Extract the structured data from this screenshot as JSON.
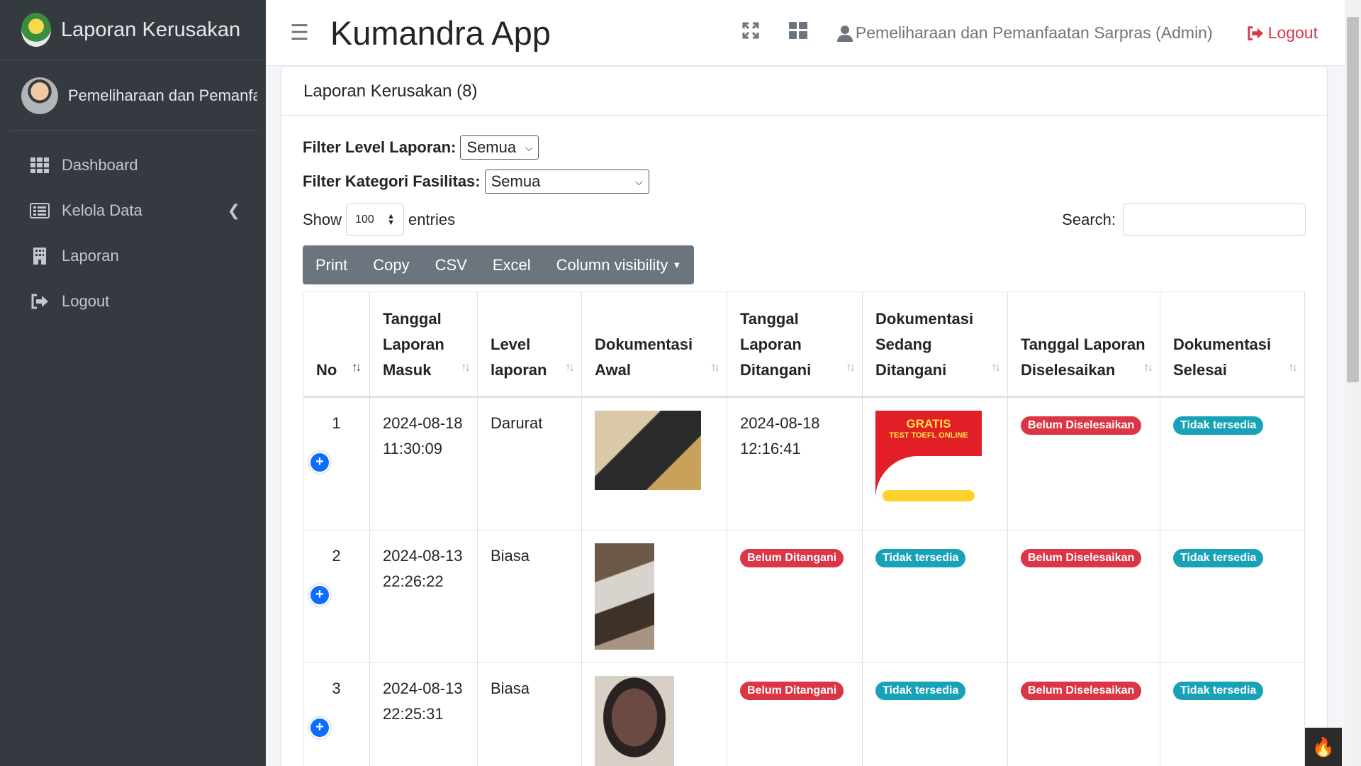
{
  "sidebar": {
    "brand": "Laporan Kerusakan",
    "user_name": "Pemeliharaan dan Pemanfaatan Sarpras",
    "menu": [
      {
        "label": "Dashboard",
        "icon": "grid-icon"
      },
      {
        "label": "Kelola Data",
        "icon": "table-icon"
      },
      {
        "label": "Laporan",
        "icon": "building-icon"
      },
      {
        "label": "Logout",
        "icon": "logout-icon"
      }
    ]
  },
  "header": {
    "title": "Kumandra App",
    "user": "Pemeliharaan dan Pemanfaatan Sarpras (Admin)",
    "logout": "Logout"
  },
  "card": {
    "title": "Laporan Kerusakan (8)",
    "filter_level_label": "Filter Level Laporan:",
    "filter_level_value": "Semua",
    "filter_kategori_label": "Filter Kategori Fasilitas:",
    "filter_kategori_value": "Semua",
    "show_label": "Show",
    "entries_value": "100",
    "entries_label": "entries",
    "search_label": "Search:",
    "buttons": [
      "Print",
      "Copy",
      "CSV",
      "Excel",
      "Column visibility"
    ]
  },
  "table": {
    "headers": [
      "No",
      "Tanggal Laporan Masuk",
      "Level laporan",
      "Dokumentasi Awal",
      "Tanggal Laporan Ditangani",
      "Dokumentasi Sedang Ditangani",
      "Tanggal Laporan Diselesaikan",
      "Dokumentasi Selesai"
    ],
    "rows": [
      {
        "no": "1",
        "masuk_date": "2024-08-18",
        "masuk_time": "11:30:09",
        "level": "Darurat",
        "ditangani_date": "2024-08-18",
        "ditangani_time": "12:16:41",
        "diselesaikan": "Belum Diselesaikan",
        "selesai": "Tidak tersedia"
      },
      {
        "no": "2",
        "masuk_date": "2024-08-13",
        "masuk_time": "22:26:22",
        "level": "Biasa",
        "ditangani_status": "Belum Ditangani",
        "sedang": "Tidak tersedia",
        "diselesaikan": "Belum Diselesaikan",
        "selesai": "Tidak tersedia"
      },
      {
        "no": "3",
        "masuk_date": "2024-08-13",
        "masuk_time": "22:25:31",
        "level": "Biasa",
        "ditangani_status": "Belum Ditangani",
        "sedang": "Tidak tersedia",
        "diselesaikan": "Belum Diselesaikan",
        "selesai": "Tidak tersedia"
      }
    ],
    "poster": {
      "line1": "GRATIS",
      "line2": "TEST TOEFL ONLINE"
    }
  },
  "colors": {
    "sidebar": "#343a40",
    "danger": "#dc3545",
    "info": "#17a2b8",
    "primary": "#0d6efd",
    "btn": "#6c757d"
  }
}
